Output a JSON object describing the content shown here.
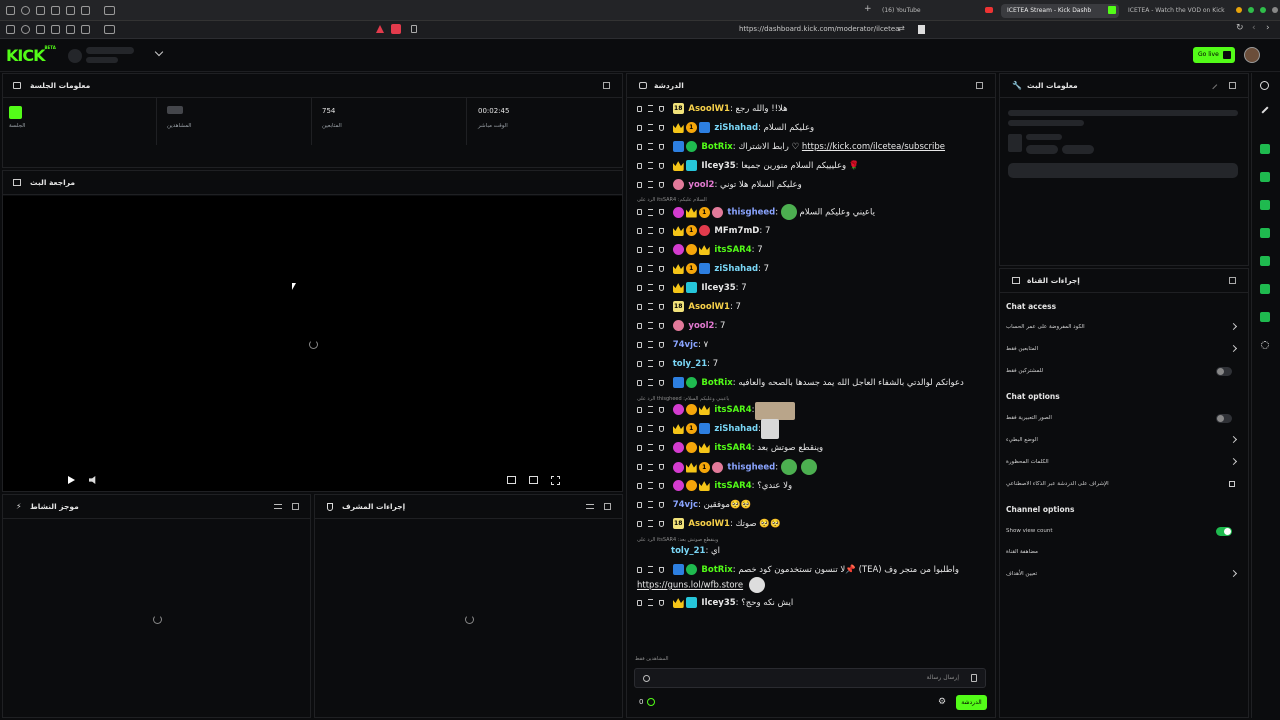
{
  "browser": {
    "tabs": [
      {
        "label": "(16) YouTube",
        "active": false
      },
      {
        "label": "ICETEA Stream - Kick Dashb",
        "active": true
      },
      {
        "label": "ICETEA - Watch the VOD on Kick",
        "active": false
      }
    ],
    "url": "https://dashboard.kick.com/moderator/ilcetea"
  },
  "header": {
    "logo": "KICK",
    "logo_sup": "BETA",
    "go_live_label": "Go live"
  },
  "session": {
    "title": "معلومات الجلسة",
    "stats": [
      {
        "value": "",
        "label": "الجلسة"
      },
      {
        "value": "",
        "label": "المشاهدين"
      },
      {
        "value": "754",
        "label": "المتابعين"
      },
      {
        "value": "00:02:45",
        "label": "الوقت مباشر"
      }
    ]
  },
  "stream_review": {
    "title": "مراجعة البث"
  },
  "activity_feed": {
    "title": "موجز النشاط"
  },
  "mod_actions": {
    "title": "إجراءات المشرف"
  },
  "chat": {
    "title": "الدردشة",
    "messages": [
      {
        "user": "AsoolW1",
        "color": "#f7d14a",
        "text": "هلا!! والله رجع"
      },
      {
        "user": "ziShahad",
        "color": "#7ad7f7",
        "text": "وعليكم السلام"
      },
      {
        "user": "BotRix",
        "color": "#53fc18",
        "text": "رابط الاشتراك ♡ ",
        "link": "https://kick.com/ilcetea/subscribe"
      },
      {
        "user": "Ilcey35",
        "color": "#e8e8e8",
        "text": "وعليييكم السلام منورين جميعا 🌹"
      },
      {
        "user": "yool2",
        "color": "#e27ad0",
        "text": "وعليكم السلام هلا توني"
      },
      {
        "reply": "الرد على itsSAR4 :السلام عليكم"
      },
      {
        "user": "thisgheed",
        "color": "#8aa4ff",
        "text": "ياعيني وعليكم السلام"
      },
      {
        "user": "MFm7mD",
        "color": "#e8e8e8",
        "text": "7"
      },
      {
        "user": "itsSAR4",
        "color": "#53fc18",
        "text": "7"
      },
      {
        "user": "ziShahad",
        "color": "#7ad7f7",
        "text": "7"
      },
      {
        "user": "Ilcey35",
        "color": "#e8e8e8",
        "text": "7"
      },
      {
        "user": "AsoolW1",
        "color": "#f7d14a",
        "text": "7"
      },
      {
        "user": "yool2",
        "color": "#e27ad0",
        "text": "7"
      },
      {
        "user": "74vjc",
        "color": "#8aa4ff",
        "text": "٧"
      },
      {
        "user": "toly_21",
        "color": "#7ad7f7",
        "text": "7"
      },
      {
        "user": "BotRix",
        "color": "#53fc18",
        "text": "دعواتكم لوالدتي بالشفاء العاجل الله يمد جسدها بالصحه والعافيه"
      },
      {
        "reply": "الرد على thisgheed :ياعيني وعليكم السلام"
      },
      {
        "user": "itsSAR4",
        "color": "#53fc18",
        "text": ""
      },
      {
        "user": "ziShahad",
        "color": "#7ad7f7",
        "text": ""
      },
      {
        "user": "itsSAR4",
        "color": "#53fc18",
        "text": "وينقطع صوتش بعد"
      },
      {
        "user": "thisgheed",
        "color": "#8aa4ff",
        "text": ""
      },
      {
        "user": "itsSAR4",
        "color": "#53fc18",
        "text": "ولا عندي؟"
      },
      {
        "user": "74vjc",
        "color": "#8aa4ff",
        "text": "موفقين🥺🥺"
      },
      {
        "user": "AsoolW1",
        "color": "#f7d14a",
        "text": "صوتك 🥺🥺"
      },
      {
        "reply": "الرد على itsSAR4 :وينقطع صوتش بعد"
      },
      {
        "user": "toly_21",
        "color": "#7ad7f7",
        "text": "اي"
      },
      {
        "user": "BotRix",
        "color": "#53fc18",
        "text": "لا تنسون تستخدمون كود خصم📌 (TEA) واطلبوا من متجر وف"
      },
      {
        "user": "Ilcey35",
        "color": "#e8e8e8",
        "text": "ايش نكه وحج؟"
      }
    ],
    "wrap_link": "https://guns.lol/wfb.store",
    "input_placeholder": "إرسال رسالة",
    "paused_hint": "المشاهدين فقط",
    "send_label": "الدردشة",
    "viewer_count": "0"
  },
  "stream_info": {
    "title": "معلومات البث"
  },
  "channel_actions": {
    "title": "إجراءات القناة",
    "sections": [
      {
        "heading": "Chat access",
        "rows": [
          {
            "label": "الكود المفروضة على عمر الحساب",
            "control": "chevron"
          },
          {
            "label": "المتابعين فقط",
            "control": "chevron"
          },
          {
            "label": "للمشتركين فقط",
            "control": "toggle-off"
          }
        ]
      },
      {
        "heading": "Chat options",
        "rows": [
          {
            "label": "الصور التعبيرية فقط",
            "control": "toggle-off"
          },
          {
            "label": "الوضع البطيء",
            "control": "chevron"
          },
          {
            "label": "الكلمات المحظورة",
            "control": "chevron"
          },
          {
            "label": "الإشراف على الدردشة عبر الذكاء الاصطناعي",
            "control": "popout"
          }
        ]
      },
      {
        "heading": "Channel options",
        "rows": [
          {
            "label": "Show view count",
            "control": "toggle-on"
          },
          {
            "label": "مضاهفة القناة",
            "control": "none"
          },
          {
            "label": "تعيين الأهداف",
            "control": "chevron"
          }
        ]
      }
    ]
  },
  "colors": {
    "accent": "#53fc18",
    "bg": "#0b0c0e"
  }
}
